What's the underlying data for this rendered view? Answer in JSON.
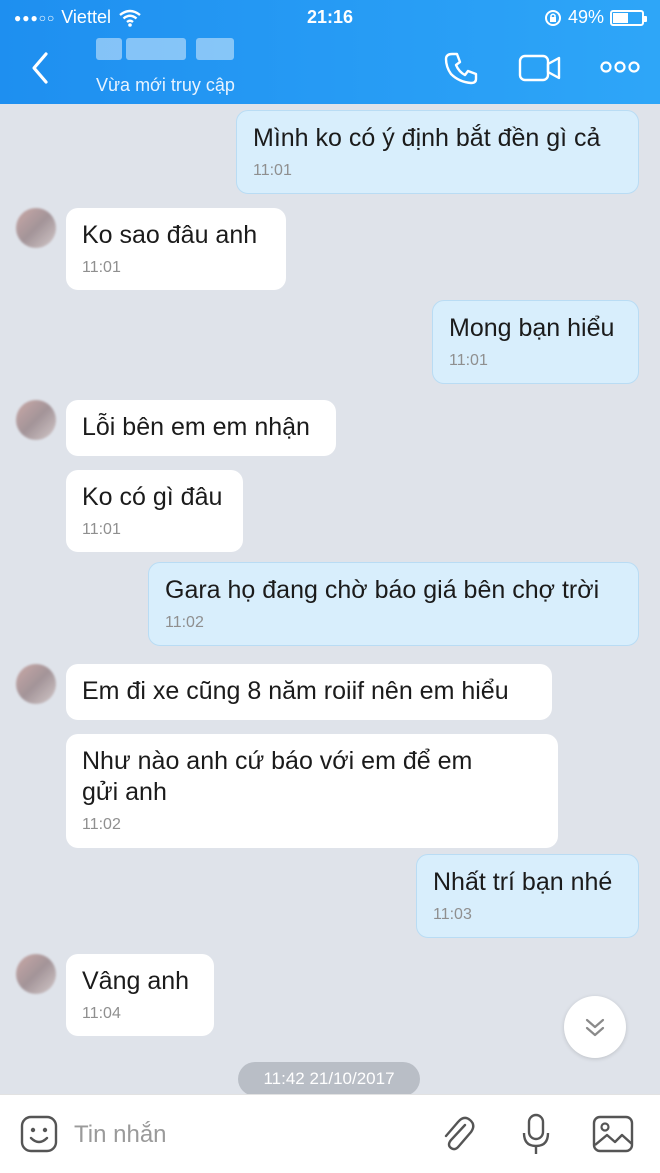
{
  "status_bar": {
    "carrier": "Viettel",
    "signal_dots": "●●●○○",
    "time": "21:16",
    "battery": "49%",
    "battery_level": 0.49
  },
  "header": {
    "contact_status": "Vừa mới truy cập",
    "icons": [
      "back-icon",
      "phone-icon",
      "video-call-icon",
      "more-icon"
    ]
  },
  "messages": [
    {
      "side": "out",
      "text": "Mình ko có ý định bắt đền gì cả",
      "time": "11:01"
    },
    {
      "side": "in",
      "text": "Ko sao đâu anh",
      "time": "11:01"
    },
    {
      "side": "out",
      "text": "Mong bạn hiểu",
      "time": "11:01"
    },
    {
      "side": "in",
      "text": "Lỗi bên em em nhận",
      "time": ""
    },
    {
      "side": "in",
      "text": "Ko có gì đâu",
      "time": "11:01"
    },
    {
      "side": "out",
      "text": "Gara họ đang chờ báo giá bên chợ trời",
      "time": "11:02"
    },
    {
      "side": "in",
      "text": "Em đi xe cũng 8 năm roiif nên em hiểu",
      "time": ""
    },
    {
      "side": "in",
      "text": "Như nào anh cứ báo với em để em gửi anh",
      "time": "11:02"
    },
    {
      "side": "out",
      "text": "Nhất trí bạn nhé",
      "time": "11:03"
    },
    {
      "side": "in",
      "text": "Vâng anh",
      "time": "11:04"
    }
  ],
  "date_separator": "11:42 21/10/2017",
  "input_bar": {
    "placeholder": "Tin nhắn",
    "icons": [
      "sticker-icon",
      "attachment-icon",
      "microphone-icon",
      "image-icon"
    ]
  },
  "colors": {
    "header_start": "#1e8ff0",
    "header_end": "#2ea6f8",
    "chat_background": "#dfe3ea",
    "outgoing_bubble": "#d8eefc",
    "incoming_bubble": "#ffffff"
  }
}
